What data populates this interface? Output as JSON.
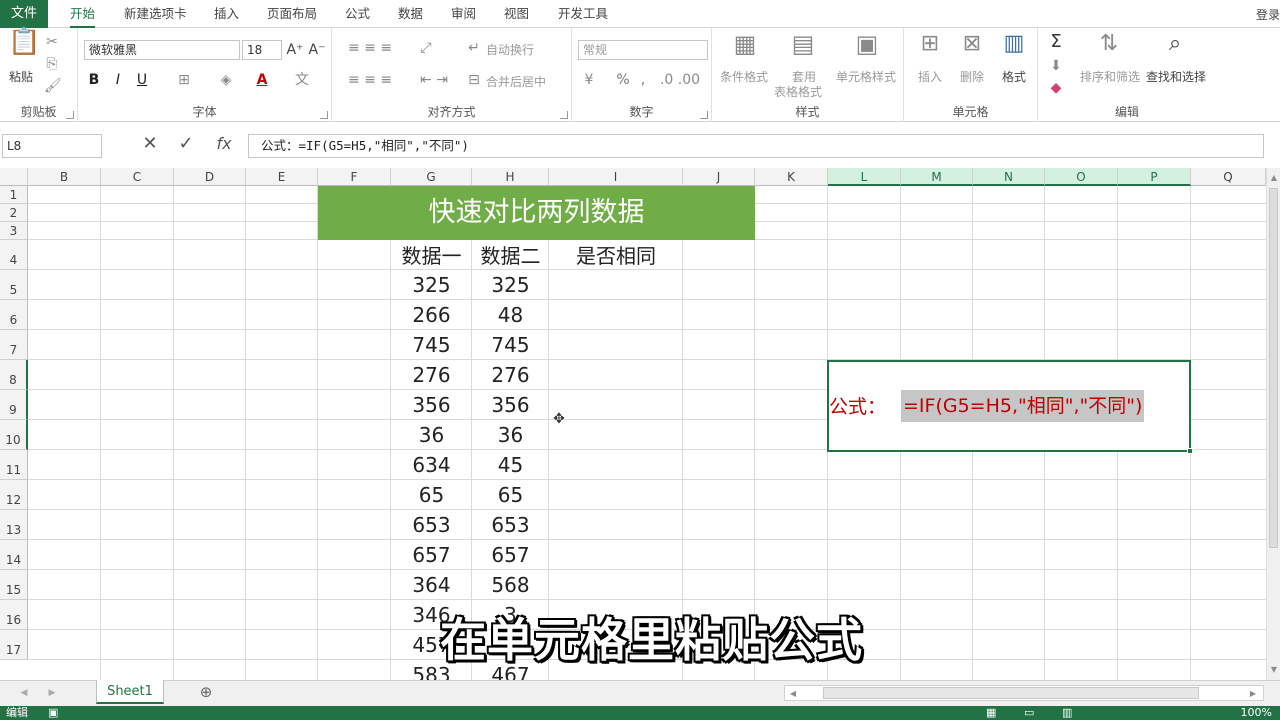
{
  "tabs": {
    "file": "文件",
    "items": [
      "开始",
      "新建选项卡",
      "插入",
      "页面布局",
      "公式",
      "数据",
      "审阅",
      "视图",
      "开发工具"
    ],
    "login": "登录"
  },
  "ribbon": {
    "clipboard": {
      "paste": "粘贴",
      "label": "剪贴板"
    },
    "font": {
      "name": "微软雅黑",
      "size": "18",
      "bold": "B",
      "italic": "I",
      "underline": "U",
      "color_a": "A",
      "label": "字体"
    },
    "align": {
      "wrap": "自动换行",
      "merge": "合并后居中",
      "label": "对齐方式"
    },
    "number": {
      "format": "常规",
      "percent": "%",
      "comma": ",",
      "label": "数字"
    },
    "styles": {
      "cond": "条件格式",
      "table1": "套用",
      "table2": "表格格式",
      "cell": "单元格样式",
      "label": "样式"
    },
    "cells": {
      "insert": "插入",
      "delete": "删除",
      "format": "格式",
      "label": "单元格"
    },
    "edit": {
      "sum": "Σ",
      "sort": "排序和筛选",
      "find": "查找和选择",
      "label": "编辑"
    }
  },
  "formula_bar": {
    "namebox": "L8",
    "fx": "fx",
    "formula": "公式：=IF(G5=H5,\"相同\",\"不同\")"
  },
  "columns": [
    "B",
    "C",
    "D",
    "E",
    "F",
    "G",
    "H",
    "I",
    "J",
    "K",
    "L",
    "M",
    "N",
    "O",
    "P",
    "Q"
  ],
  "rows": [
    "1",
    "2",
    "3",
    "4",
    "5",
    "6",
    "7",
    "8",
    "9",
    "10",
    "11",
    "12",
    "13",
    "14",
    "15",
    "16",
    "17"
  ],
  "sheet": {
    "title": "快速对比两列数据",
    "headers": [
      "数据一",
      "数据二",
      "是否相同"
    ],
    "data1": [
      "325",
      "266",
      "745",
      "276",
      "356",
      "36",
      "634",
      "65",
      "653",
      "657",
      "364",
      "346",
      "457",
      "583"
    ],
    "data2": [
      "325",
      "48",
      "745",
      "276",
      "356",
      "36",
      "45",
      "65",
      "653",
      "657",
      "568",
      "3",
      "3",
      "467"
    ],
    "note_label": "公式：",
    "note_formula": "=IF(G5=H5,\"相同\",\"不同\")"
  },
  "subtitle": "在单元格里粘贴公式",
  "sheet_tab": "Sheet1",
  "status": {
    "mode": "编辑",
    "zoom": "100%"
  }
}
